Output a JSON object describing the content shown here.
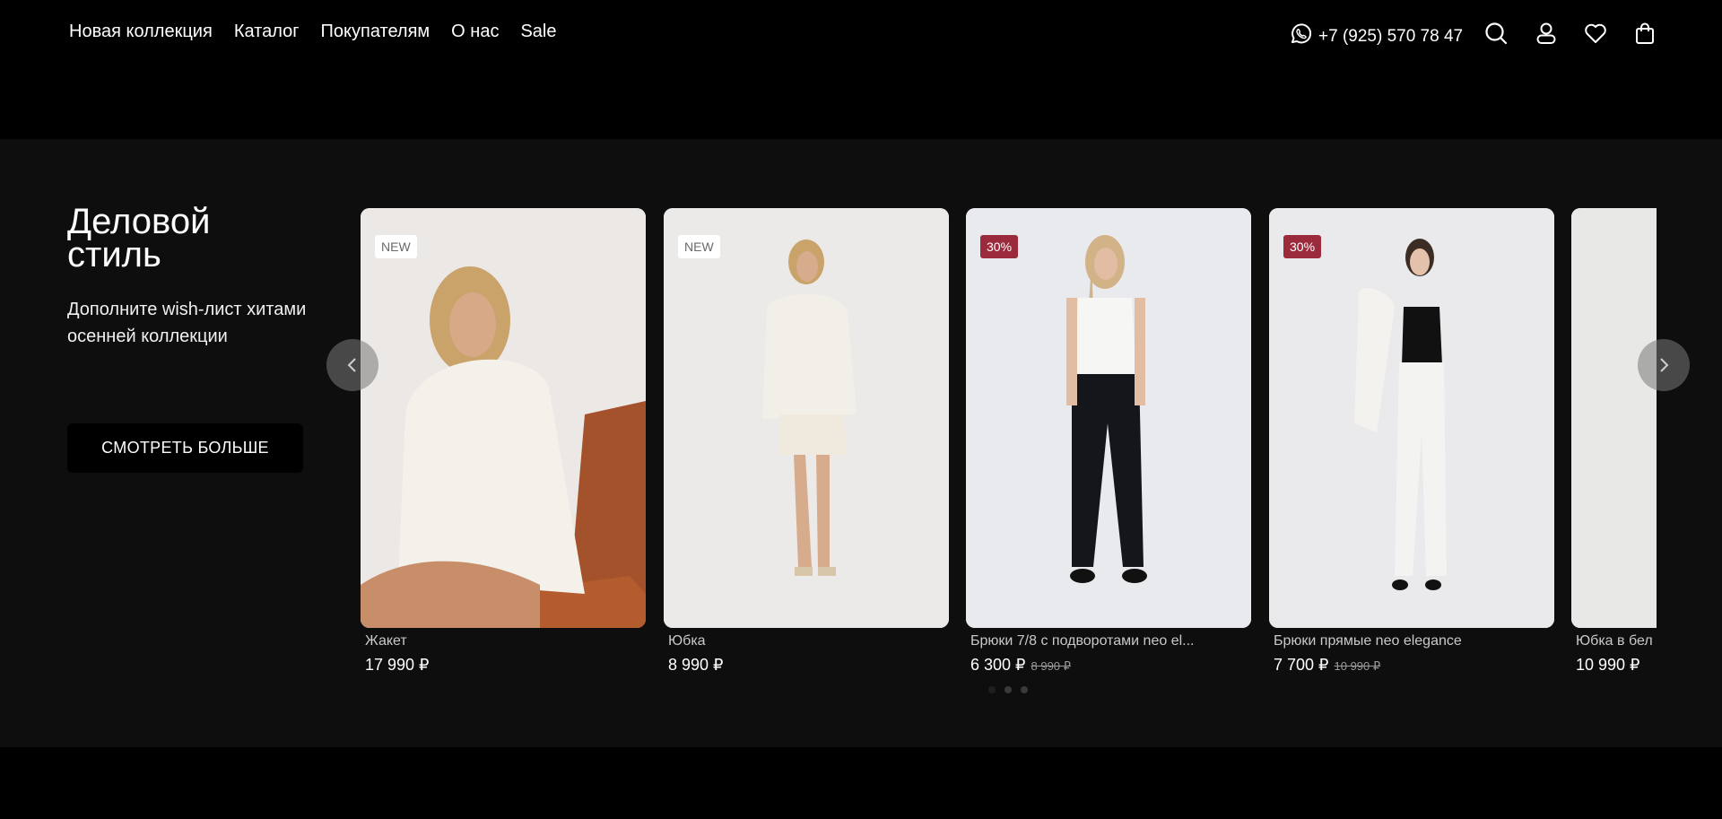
{
  "nav": {
    "links": [
      "Новая коллекция",
      "Каталог",
      "Покупателям",
      "О нас",
      "Sale"
    ]
  },
  "header": {
    "phone": "+7 (925) 570 78 47",
    "icons": [
      "whatsapp-icon",
      "search-icon",
      "user-icon",
      "heart-icon",
      "bag-icon"
    ]
  },
  "promo": {
    "title": "Деловой стиль",
    "subtitle": "Дополните wish-лист хитами осенней коллекции",
    "button": "СМОТРЕТЬ БОЛЬШЕ"
  },
  "colors": {
    "sale_badge": "#9b2a3d",
    "section_bg": "#0e0e0e",
    "header_bg": "#000000"
  },
  "products": [
    {
      "title": "Жакет",
      "price": "17 990 ₽",
      "old_price": "",
      "badge": "NEW"
    },
    {
      "title": "Юбка",
      "price": "8 990 ₽",
      "old_price": "",
      "badge": "NEW"
    },
    {
      "title": "Брюки 7/8 с подворотами neo el...",
      "price": "6 300 ₽",
      "old_price": "8 990 ₽",
      "badge": "30%"
    },
    {
      "title": "Брюки прямые neo elegance",
      "price": "7 700 ₽",
      "old_price": "10 990 ₽",
      "badge": "30%"
    },
    {
      "title": "Юбка в бел",
      "price": "10 990 ₽",
      "old_price": "",
      "badge": ""
    }
  ],
  "carousel": {
    "pages": 3,
    "active_page": 1
  }
}
